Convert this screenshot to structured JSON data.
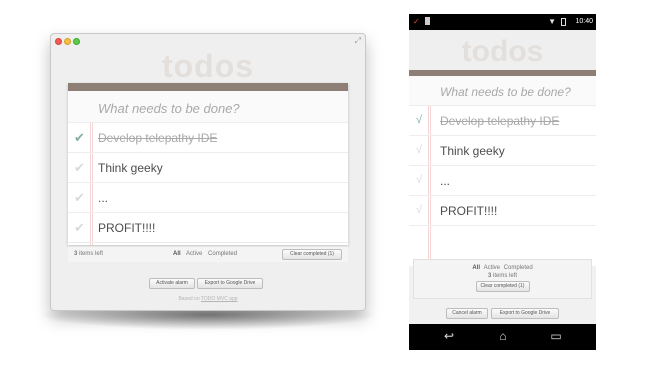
{
  "app": {
    "title": "todos",
    "placeholder": "What needs to be done?",
    "colors": {
      "accent": "#8d7f76",
      "checked": "#85ada7",
      "unchecked": "#d9d9d9"
    }
  },
  "desktop": {
    "todos": [
      {
        "text": "Develop telepathy IDE",
        "done": true
      },
      {
        "text": "Think geeky",
        "done": false
      },
      {
        "text": "...",
        "done": false
      },
      {
        "text": "PROFIT!!!!",
        "done": false
      }
    ],
    "footer": {
      "count": "3",
      "items_left": "items left",
      "filters": [
        "All",
        "Active",
        "Completed"
      ],
      "clear": "Clear completed (1)"
    },
    "actions": {
      "alarm": "Activate alarm",
      "export": "Export to Google Drive"
    },
    "credit": {
      "prefix": "Based on",
      "link": "TODO MVC app"
    }
  },
  "mobile": {
    "status": {
      "time": "10:40"
    },
    "todos": [
      {
        "text": "Develop telepathy IDE",
        "done": true
      },
      {
        "text": "Think geeky",
        "done": false
      },
      {
        "text": "...",
        "done": false
      },
      {
        "text": "PROFIT!!!!",
        "done": false
      }
    ],
    "footer": {
      "filters": [
        "All",
        "Active",
        "Completed"
      ],
      "count": "3",
      "items_left": "items left",
      "clear": "Clear completed (1)"
    },
    "actions": {
      "alarm": "Cancel alarm",
      "export": "Export to Google Drive"
    }
  }
}
